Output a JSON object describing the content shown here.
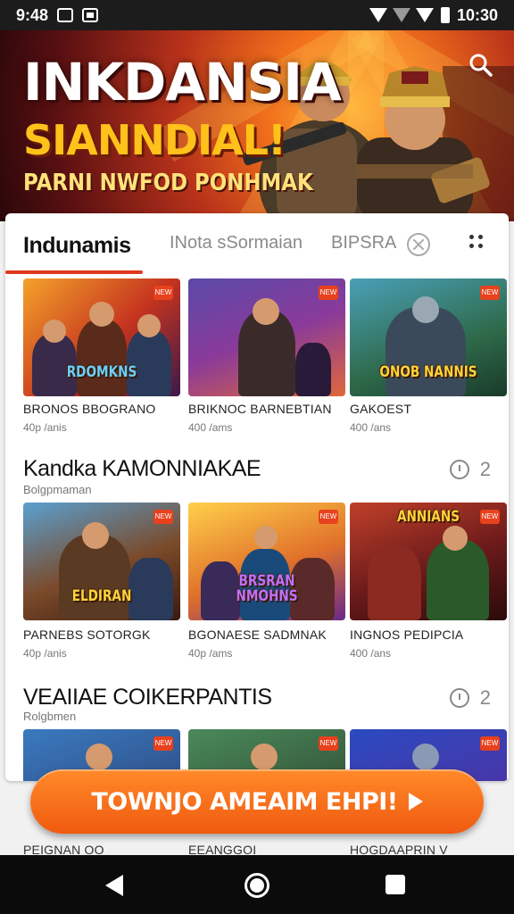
{
  "status_bar": {
    "time": "9:48",
    "clock_right": "10:30"
  },
  "hero": {
    "title": "INKDANSIA",
    "subtitle": "SIANNDIAL!",
    "tagline": "PARNI NWFOD PONHMAK"
  },
  "tabs": {
    "active": "Indunamis",
    "second": "INota sSormaian",
    "third": "BIPSRA"
  },
  "rows": [
    {
      "games": [
        {
          "logo": "RDOMKNS",
          "name": "BRONOS BBOGRANO",
          "meta": "40p /anis"
        },
        {
          "logo": "",
          "name": "BRIKNOC BARNEBTIAN",
          "meta": "400 /ams"
        },
        {
          "logo": "ONOB NANNIS",
          "name": "GAKOEST",
          "meta": "400 /ans"
        }
      ]
    },
    {
      "games": [
        {
          "logo": "ELDIRAN",
          "name": "PARNEBS SOTORGK",
          "meta": "40p /anis"
        },
        {
          "logo": "BRSRAN NMOHNS",
          "name": "BGONAESE SADMNAK",
          "meta": "40p /ams"
        },
        {
          "logo": "ANNIANS",
          "name": "INGNOS PEDIPCIA",
          "meta": "400 /ans"
        }
      ]
    }
  ],
  "sections": [
    {
      "title": "Kandka KAMONNIAKAE",
      "sub": "Bolgpmaman",
      "count": "2"
    },
    {
      "title": "VEAIIAE COIKERPANTIS",
      "sub": "Rolgbmen",
      "count": "2"
    }
  ],
  "peek_row": {
    "captions": [
      "PEIGNAN OO",
      "EEANGGOI",
      "HOGDAAPRIN V"
    ]
  },
  "cta": {
    "label": "TOWNJO AMEAIM EHPI!"
  },
  "icons": {
    "search": "search-icon",
    "favorite": "no-entry-icon",
    "more": "more-vertical-icon",
    "history": "clock-icon",
    "back": "back-icon",
    "home": "home-icon",
    "recents": "recents-icon"
  },
  "colors": {
    "accent": "#e0391f",
    "cta": "#f2661a",
    "hero_orange": "#f2711c",
    "title_gold": "#ffc21a"
  }
}
